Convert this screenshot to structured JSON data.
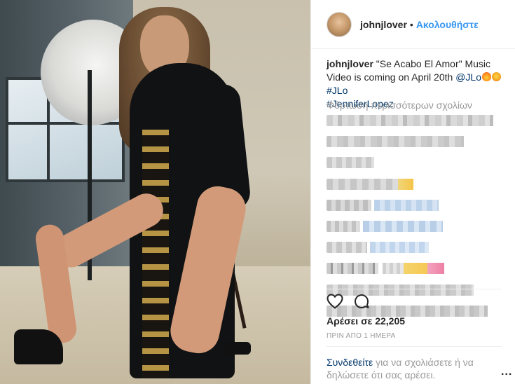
{
  "post": {
    "username": "johnjlover",
    "separator": "•",
    "follow_label": "Ακολουθήστε",
    "caption": {
      "username": "johnjlover",
      "text": "\"Se Acabo El Amor\" Music Video is coming on April 20th",
      "mention": "@JLo",
      "hashtag1": "#JLo",
      "hashtag2": "#JenniferLopez"
    },
    "load_more_comments": "Φόρτωση περισσότερων σχολίων",
    "likes_text": "Αρέσει σε 22,205",
    "timestamp": "ΠΡΙΝ ΑΠΟ 1 ΗΜΕΡΑ",
    "login_prompt": {
      "link": "Συνδεθείτε",
      "text": "για να σχολιάσετε ή να δηλώσετε ότι σας αρέσει."
    },
    "more_options": "..."
  },
  "icons": {
    "like": "heart-icon",
    "comment": "comment-icon",
    "more": "more-options-icon"
  },
  "colors": {
    "link_blue": "#3897f0",
    "tag_blue": "#003569",
    "muted": "#999999",
    "text": "#262626"
  }
}
